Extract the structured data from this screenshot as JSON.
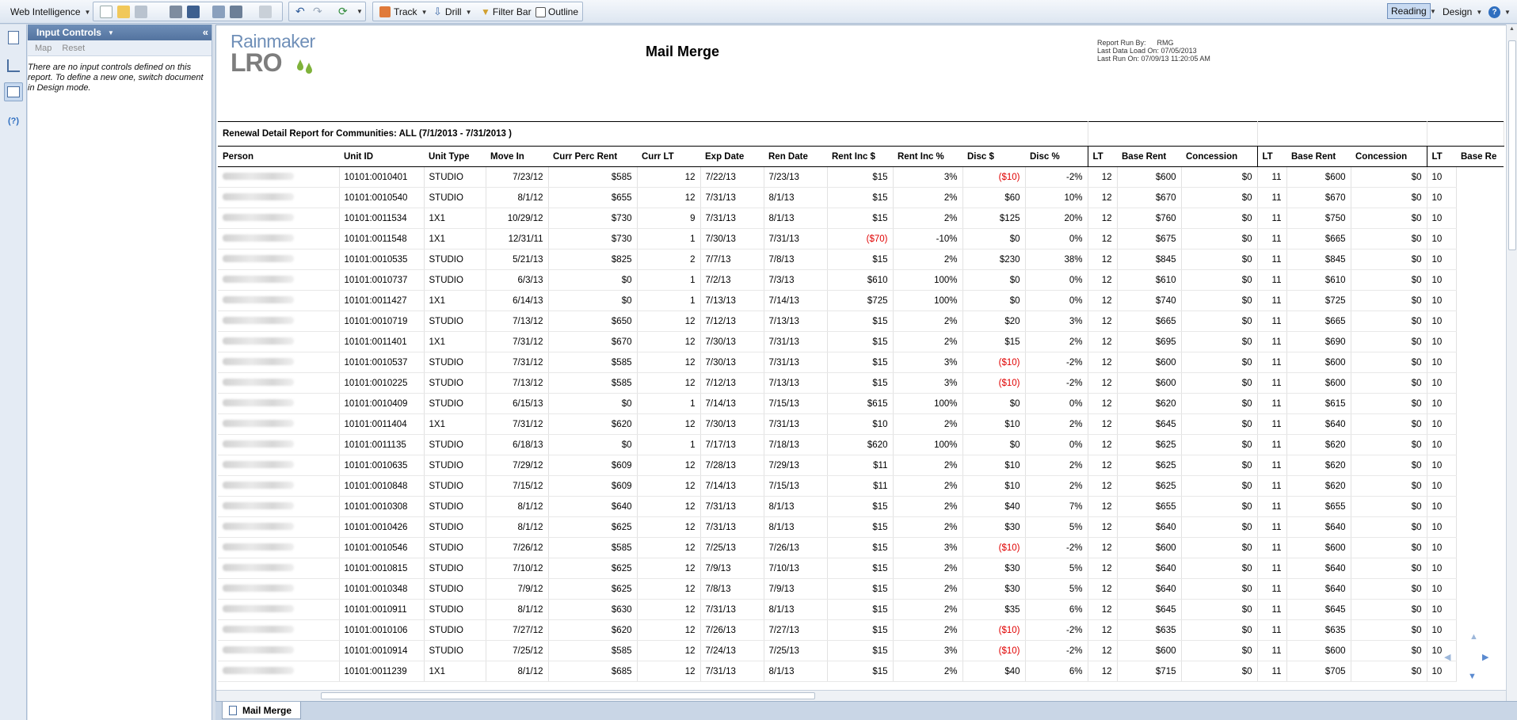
{
  "toolbar": {
    "app_menu": "Web Intelligence",
    "track": "Track",
    "drill": "Drill",
    "filter_bar": "Filter Bar",
    "outline": "Outline",
    "reading": "Reading",
    "design": "Design",
    "help": "?"
  },
  "input_controls": {
    "title": "Input Controls",
    "map": "Map",
    "reset": "Reset",
    "message": "There are no input controls defined on this report. To define a new one, switch document in Design mode."
  },
  "report": {
    "logo_top": "Rainmaker",
    "logo_bottom": "LRO",
    "title": "Mail Merge",
    "run_by_label": "Report Run By:",
    "run_by": "RMG",
    "last_load": "Last Data Load On: 07/05/2013",
    "last_run": "Last Run On: 07/09/13 11:20:05 AM",
    "caption": "Renewal Detail Report for Communities:  ALL  (7/1/2013   -  7/31/2013 )",
    "headers": [
      "Person",
      "Unit ID",
      "Unit Type",
      "Move In",
      "Curr Perc Rent",
      "Curr LT",
      "Exp Date",
      "Ren Date",
      "Rent Inc $",
      "Rent Inc %",
      "Disc $",
      "Disc %",
      "LT",
      "Base Rent",
      "Concession",
      "LT",
      "Base Rent",
      "Concession",
      "LT",
      "Base Re"
    ],
    "rows": [
      [
        "10101:0010401",
        "STUDIO",
        "7/23/12",
        "$585",
        "12",
        "7/22/13",
        "7/23/13",
        "$15",
        "3%",
        "($10)",
        "-2%",
        "12",
        "$600",
        "$0",
        "11",
        "$600",
        "$0",
        "10"
      ],
      [
        "10101:0010540",
        "STUDIO",
        "8/1/12",
        "$655",
        "12",
        "7/31/13",
        "8/1/13",
        "$15",
        "2%",
        "$60",
        "10%",
        "12",
        "$670",
        "$0",
        "11",
        "$670",
        "$0",
        "10"
      ],
      [
        "10101:0011534",
        "1X1",
        "10/29/12",
        "$730",
        "9",
        "7/31/13",
        "8/1/13",
        "$15",
        "2%",
        "$125",
        "20%",
        "12",
        "$760",
        "$0",
        "11",
        "$750",
        "$0",
        "10"
      ],
      [
        "10101:0011548",
        "1X1",
        "12/31/11",
        "$730",
        "1",
        "7/30/13",
        "7/31/13",
        "($70)",
        "-10%",
        "$0",
        "0%",
        "12",
        "$675",
        "$0",
        "11",
        "$665",
        "$0",
        "10"
      ],
      [
        "10101:0010535",
        "STUDIO",
        "5/21/13",
        "$825",
        "2",
        "7/7/13",
        "7/8/13",
        "$15",
        "2%",
        "$230",
        "38%",
        "12",
        "$845",
        "$0",
        "11",
        "$845",
        "$0",
        "10"
      ],
      [
        "10101:0010737",
        "STUDIO",
        "6/3/13",
        "$0",
        "1",
        "7/2/13",
        "7/3/13",
        "$610",
        "100%",
        "$0",
        "0%",
        "12",
        "$610",
        "$0",
        "11",
        "$610",
        "$0",
        "10"
      ],
      [
        "10101:0011427",
        "1X1",
        "6/14/13",
        "$0",
        "1",
        "7/13/13",
        "7/14/13",
        "$725",
        "100%",
        "$0",
        "0%",
        "12",
        "$740",
        "$0",
        "11",
        "$725",
        "$0",
        "10"
      ],
      [
        "10101:0010719",
        "STUDIO",
        "7/13/12",
        "$650",
        "12",
        "7/12/13",
        "7/13/13",
        "$15",
        "2%",
        "$20",
        "3%",
        "12",
        "$665",
        "$0",
        "11",
        "$665",
        "$0",
        "10"
      ],
      [
        "10101:0011401",
        "1X1",
        "7/31/12",
        "$670",
        "12",
        "7/30/13",
        "7/31/13",
        "$15",
        "2%",
        "$15",
        "2%",
        "12",
        "$695",
        "$0",
        "11",
        "$690",
        "$0",
        "10"
      ],
      [
        "10101:0010537",
        "STUDIO",
        "7/31/12",
        "$585",
        "12",
        "7/30/13",
        "7/31/13",
        "$15",
        "3%",
        "($10)",
        "-2%",
        "12",
        "$600",
        "$0",
        "11",
        "$600",
        "$0",
        "10"
      ],
      [
        "10101:0010225",
        "STUDIO",
        "7/13/12",
        "$585",
        "12",
        "7/12/13",
        "7/13/13",
        "$15",
        "3%",
        "($10)",
        "-2%",
        "12",
        "$600",
        "$0",
        "11",
        "$600",
        "$0",
        "10"
      ],
      [
        "10101:0010409",
        "STUDIO",
        "6/15/13",
        "$0",
        "1",
        "7/14/13",
        "7/15/13",
        "$615",
        "100%",
        "$0",
        "0%",
        "12",
        "$620",
        "$0",
        "11",
        "$615",
        "$0",
        "10"
      ],
      [
        "10101:0011404",
        "1X1",
        "7/31/12",
        "$620",
        "12",
        "7/30/13",
        "7/31/13",
        "$10",
        "2%",
        "$10",
        "2%",
        "12",
        "$645",
        "$0",
        "11",
        "$640",
        "$0",
        "10"
      ],
      [
        "10101:0011135",
        "STUDIO",
        "6/18/13",
        "$0",
        "1",
        "7/17/13",
        "7/18/13",
        "$620",
        "100%",
        "$0",
        "0%",
        "12",
        "$625",
        "$0",
        "11",
        "$620",
        "$0",
        "10"
      ],
      [
        "10101:0010635",
        "STUDIO",
        "7/29/12",
        "$609",
        "12",
        "7/28/13",
        "7/29/13",
        "$11",
        "2%",
        "$10",
        "2%",
        "12",
        "$625",
        "$0",
        "11",
        "$620",
        "$0",
        "10"
      ],
      [
        "10101:0010848",
        "STUDIO",
        "7/15/12",
        "$609",
        "12",
        "7/14/13",
        "7/15/13",
        "$11",
        "2%",
        "$10",
        "2%",
        "12",
        "$625",
        "$0",
        "11",
        "$620",
        "$0",
        "10"
      ],
      [
        "10101:0010308",
        "STUDIO",
        "8/1/12",
        "$640",
        "12",
        "7/31/13",
        "8/1/13",
        "$15",
        "2%",
        "$40",
        "7%",
        "12",
        "$655",
        "$0",
        "11",
        "$655",
        "$0",
        "10"
      ],
      [
        "10101:0010426",
        "STUDIO",
        "8/1/12",
        "$625",
        "12",
        "7/31/13",
        "8/1/13",
        "$15",
        "2%",
        "$30",
        "5%",
        "12",
        "$640",
        "$0",
        "11",
        "$640",
        "$0",
        "10"
      ],
      [
        "10101:0010546",
        "STUDIO",
        "7/26/12",
        "$585",
        "12",
        "7/25/13",
        "7/26/13",
        "$15",
        "3%",
        "($10)",
        "-2%",
        "12",
        "$600",
        "$0",
        "11",
        "$600",
        "$0",
        "10"
      ],
      [
        "10101:0010815",
        "STUDIO",
        "7/10/12",
        "$625",
        "12",
        "7/9/13",
        "7/10/13",
        "$15",
        "2%",
        "$30",
        "5%",
        "12",
        "$640",
        "$0",
        "11",
        "$640",
        "$0",
        "10"
      ],
      [
        "10101:0010348",
        "STUDIO",
        "7/9/12",
        "$625",
        "12",
        "7/8/13",
        "7/9/13",
        "$15",
        "2%",
        "$30",
        "5%",
        "12",
        "$640",
        "$0",
        "11",
        "$640",
        "$0",
        "10"
      ],
      [
        "10101:0010911",
        "STUDIO",
        "8/1/12",
        "$630",
        "12",
        "7/31/13",
        "8/1/13",
        "$15",
        "2%",
        "$35",
        "6%",
        "12",
        "$645",
        "$0",
        "11",
        "$645",
        "$0",
        "10"
      ],
      [
        "10101:0010106",
        "STUDIO",
        "7/27/12",
        "$620",
        "12",
        "7/26/13",
        "7/27/13",
        "$15",
        "2%",
        "($10)",
        "-2%",
        "12",
        "$635",
        "$0",
        "11",
        "$635",
        "$0",
        "10"
      ],
      [
        "10101:0010914",
        "STUDIO",
        "7/25/12",
        "$585",
        "12",
        "7/24/13",
        "7/25/13",
        "$15",
        "3%",
        "($10)",
        "-2%",
        "12",
        "$600",
        "$0",
        "11",
        "$600",
        "$0",
        "10"
      ],
      [
        "10101:0011239",
        "1X1",
        "8/1/12",
        "$685",
        "12",
        "7/31/13",
        "8/1/13",
        "$15",
        "2%",
        "$40",
        "6%",
        "12",
        "$715",
        "$0",
        "11",
        "$705",
        "$0",
        "10"
      ]
    ]
  },
  "tabs": [
    "Mail Merge"
  ],
  "colors": {
    "negative": "#e00000",
    "header_blue": "#5b7ba6"
  }
}
